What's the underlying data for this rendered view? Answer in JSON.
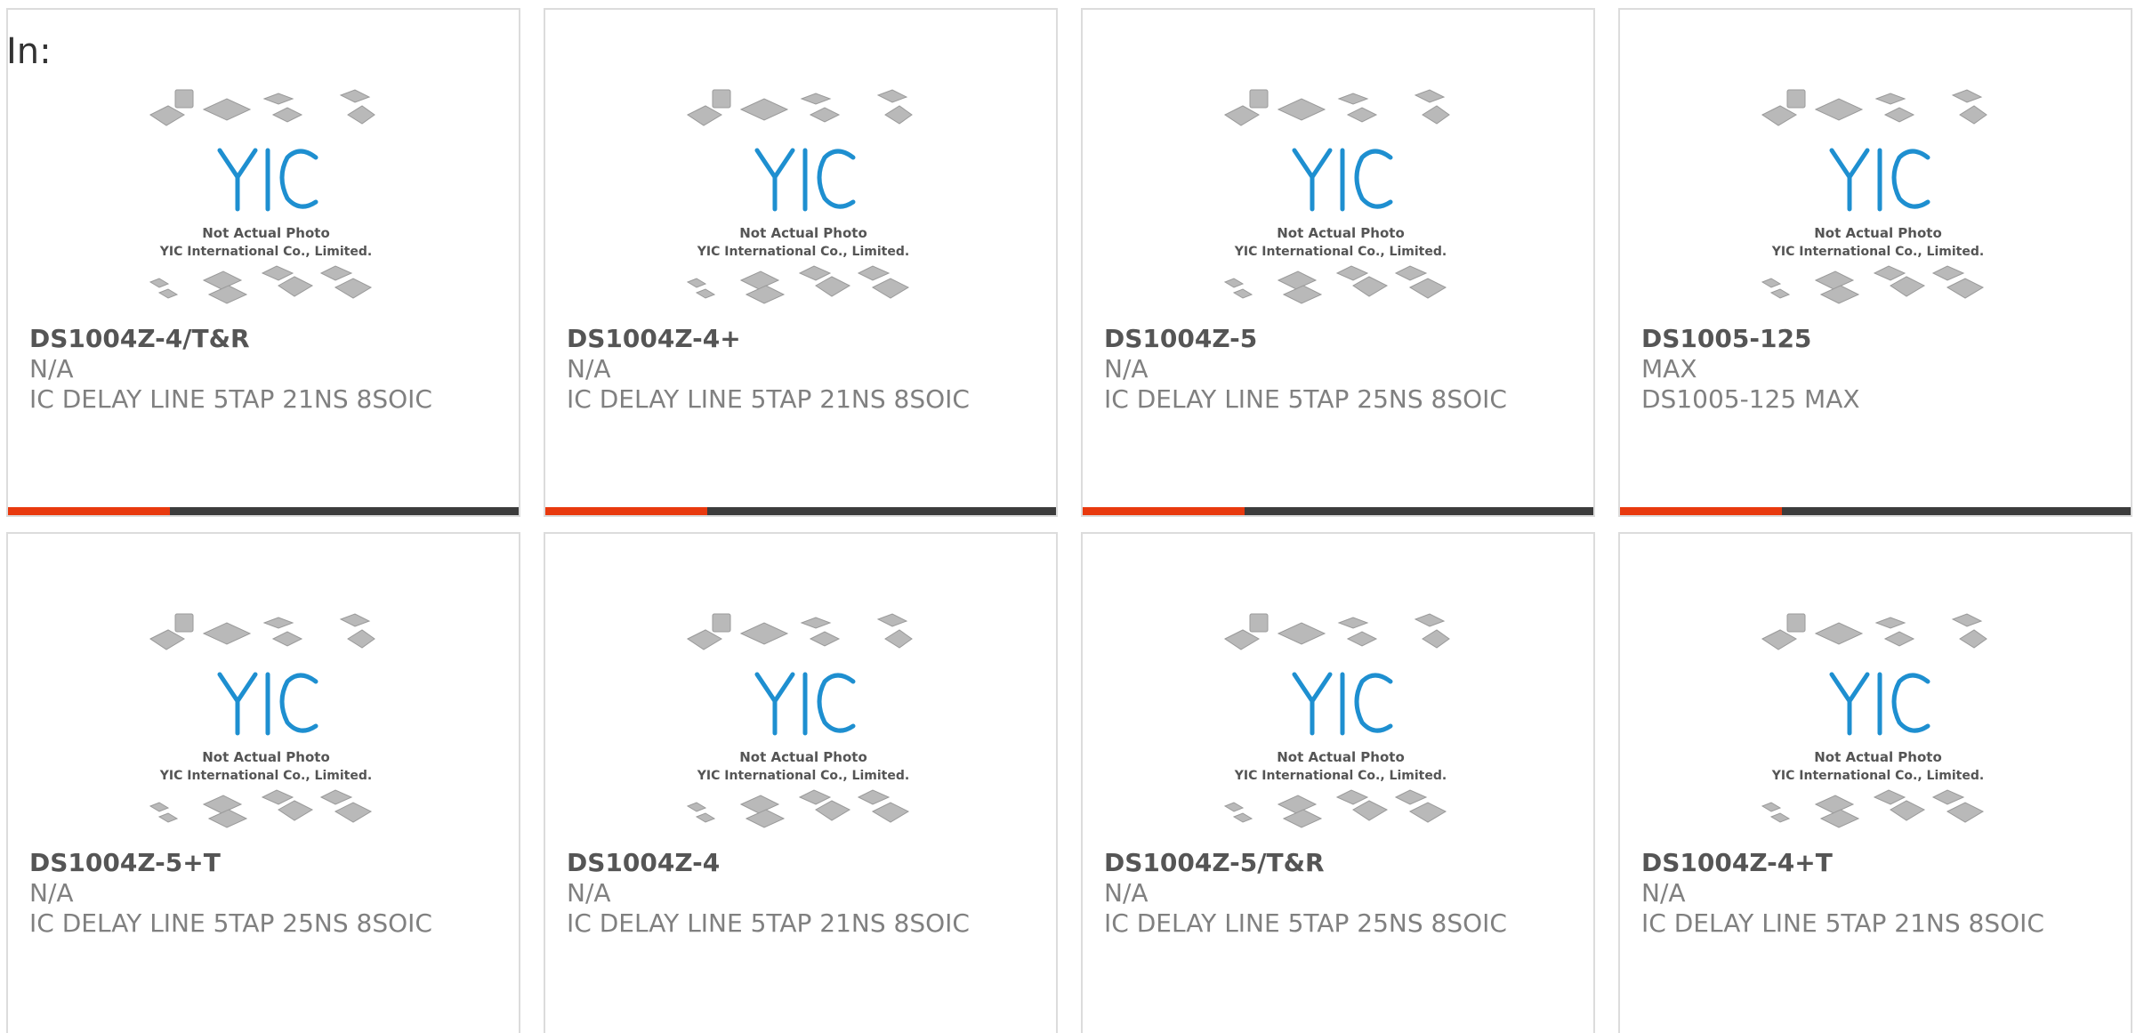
{
  "header": {
    "in_label": "In:"
  },
  "placeholder": {
    "line1": "Not Actual Photo",
    "line2": "YIC International Co., Limited.",
    "logo": "YIC"
  },
  "colors": {
    "accent": "#e8390e",
    "bar": "#3c3c3c",
    "logo_blue": "#1e8fd0"
  },
  "products": [
    {
      "part": "DS1004Z-4/T&R",
      "manufacturer": "N/A",
      "description": "IC DELAY LINE 5TAP 21NS 8SOIC"
    },
    {
      "part": "DS1004Z-4+",
      "manufacturer": "N/A",
      "description": "IC DELAY LINE 5TAP 21NS 8SOIC"
    },
    {
      "part": "DS1004Z-5",
      "manufacturer": "N/A",
      "description": "IC DELAY LINE 5TAP 25NS 8SOIC"
    },
    {
      "part": "DS1005-125",
      "manufacturer": "MAX",
      "description": "DS1005-125 MAX"
    },
    {
      "part": "DS1004Z-5+T",
      "manufacturer": "N/A",
      "description": "IC DELAY LINE 5TAP 25NS 8SOIC"
    },
    {
      "part": "DS1004Z-4",
      "manufacturer": "N/A",
      "description": "IC DELAY LINE 5TAP 21NS 8SOIC"
    },
    {
      "part": "DS1004Z-5/T&R",
      "manufacturer": "N/A",
      "description": "IC DELAY LINE 5TAP 25NS 8SOIC"
    },
    {
      "part": "DS1004Z-4+T",
      "manufacturer": "N/A",
      "description": "IC DELAY LINE 5TAP 21NS 8SOIC"
    }
  ]
}
